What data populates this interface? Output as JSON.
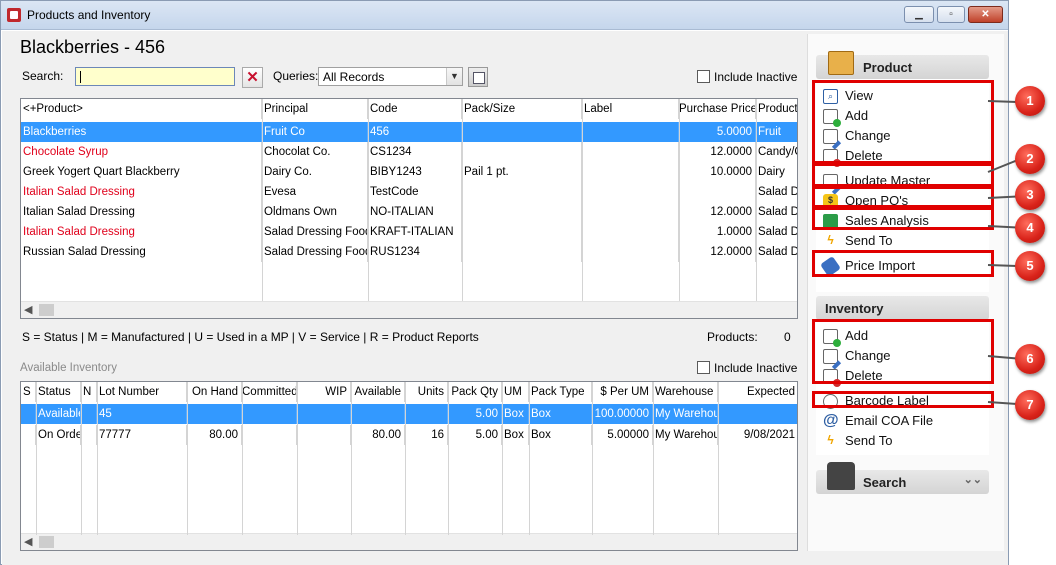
{
  "window": {
    "title": "Products and Inventory"
  },
  "header": {
    "title": "Blackberries - 456",
    "search_label": "Search:",
    "search_value": "",
    "queries_label": "Queries:",
    "queries_value": "All Records",
    "include_inactive_label": "Include Inactive"
  },
  "products_table": {
    "columns": [
      "<+Product>",
      "Principal",
      "Code",
      "Pack/Size",
      "Label",
      "Purchase Price",
      "Product"
    ],
    "rows": [
      {
        "product": "Blackberries",
        "principal": "Fruit Co",
        "code": "456",
        "pack": "",
        "label": "",
        "price": "5.0000",
        "category": "Fruit",
        "selected": true,
        "red": false
      },
      {
        "product": "Chocolate Syrup",
        "principal": "Chocolat Co.",
        "code": "CS1234",
        "pack": "",
        "label": "",
        "price": "12.0000",
        "category": "Candy/C",
        "selected": false,
        "red": true
      },
      {
        "product": "Greek Yogert Quart Blackberry",
        "principal": "Dairy Co.",
        "code": "BIBY1243",
        "pack": "Pail 1 pt.",
        "label": "",
        "price": "10.0000",
        "category": "Dairy",
        "selected": false,
        "red": false
      },
      {
        "product": "Italian Salad Dressing",
        "principal": "Evesa",
        "code": "TestCode",
        "pack": "",
        "label": "",
        "price": "",
        "category": "Salad Dr",
        "selected": false,
        "red": true
      },
      {
        "product": "Italian Salad Dressing",
        "principal": "Oldmans Own",
        "code": "NO-ITALIAN",
        "pack": "",
        "label": "",
        "price": "12.0000",
        "category": "Salad Dr",
        "selected": false,
        "red": false
      },
      {
        "product": "Italian Salad Dressing",
        "principal": "Salad Dressing Food C",
        "code": "KRAFT-ITALIAN",
        "pack": "",
        "label": "",
        "price": "1.0000",
        "category": "Salad Dr",
        "selected": false,
        "red": true
      },
      {
        "product": "Russian Salad Dressing",
        "principal": "Salad Dressing Food C",
        "code": "RUS1234",
        "pack": "",
        "label": "",
        "price": "12.0000",
        "category": "Salad Dr",
        "selected": false,
        "red": false
      }
    ]
  },
  "legend_text": "S = Status | M = Manufactured | U = Used in a MP | V = Service | R = Product Reports",
  "products_count_label": "Products:",
  "products_count": "0",
  "inventory": {
    "title": "Available Inventory",
    "include_inactive_label": "Include Inactive",
    "columns": [
      "S",
      "Status",
      "N",
      "Lot Number",
      "On Hand",
      "Committed",
      "WIP",
      "Available",
      "Units",
      "Pack Qty",
      "UM",
      "Pack Type",
      "$ Per UM",
      "Warehouse",
      "Expected"
    ],
    "rows": [
      {
        "s": "",
        "status": "Available",
        "n": "",
        "lot": "45",
        "onhand": "",
        "committed": "",
        "wip": "",
        "available": "",
        "units": "",
        "packqty": "5.00",
        "um": "Box",
        "packtype": "Box",
        "perum": "100.00000",
        "warehouse": "My Warehou",
        "expected": "",
        "selected": true
      },
      {
        "s": "",
        "status": "On Order",
        "n": "",
        "lot": "77777",
        "onhand": "80.00",
        "committed": "",
        "wip": "",
        "available": "80.00",
        "units": "16",
        "packqty": "5.00",
        "um": "Box",
        "packtype": "Box",
        "perum": "5.00000",
        "warehouse": "My Warehou",
        "expected": "9/08/2021",
        "selected": false
      }
    ]
  },
  "sidebar": {
    "product_panel": {
      "title": "Product",
      "items": [
        "View",
        "Add",
        "Change",
        "Delete",
        "Update Master",
        "Open PO's",
        "Sales Analysis",
        "Send To",
        "Price Import"
      ]
    },
    "inventory_panel": {
      "title": "Inventory",
      "items": [
        "Add",
        "Change",
        "Delete",
        "Barcode Label",
        "Email COA File",
        "Send To"
      ]
    },
    "search_panel": {
      "title": "Search"
    }
  },
  "callouts": [
    "1",
    "2",
    "3",
    "4",
    "5",
    "6",
    "7"
  ],
  "colors": {
    "selection": "#3399ff",
    "inactive_red": "#e0001b",
    "highlight_box": "#e00000",
    "callout": "#d9231a"
  }
}
